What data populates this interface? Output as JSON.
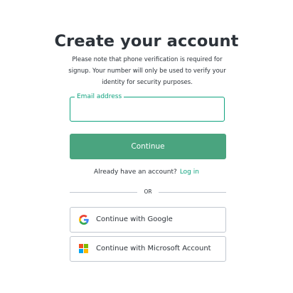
{
  "header": {
    "title": "Create your account",
    "note": "Please note that phone verification is required for signup. Your number will only be used to verify your identity for security purposes."
  },
  "form": {
    "email_label": "Email address",
    "email_value": "",
    "continue_label": "Continue"
  },
  "login": {
    "prompt": "Already have an account?",
    "link_label": "Log in"
  },
  "divider": {
    "label": "OR"
  },
  "social": [
    {
      "label": "Continue with Google",
      "icon": "google-icon"
    },
    {
      "label": "Continue with Microsoft Account",
      "icon": "microsoft-icon"
    }
  ],
  "colors": {
    "accent": "#10a37f",
    "button": "#4aa47f",
    "text": "#2d333a",
    "border": "#c2c8d0",
    "google_blue": "#4285F4",
    "google_red": "#EA4335",
    "google_yellow": "#FBBC05",
    "google_green": "#34A853",
    "ms_red": "#F25022",
    "ms_green": "#7FBA00",
    "ms_blue": "#00A4EF",
    "ms_yellow": "#FFB900"
  }
}
